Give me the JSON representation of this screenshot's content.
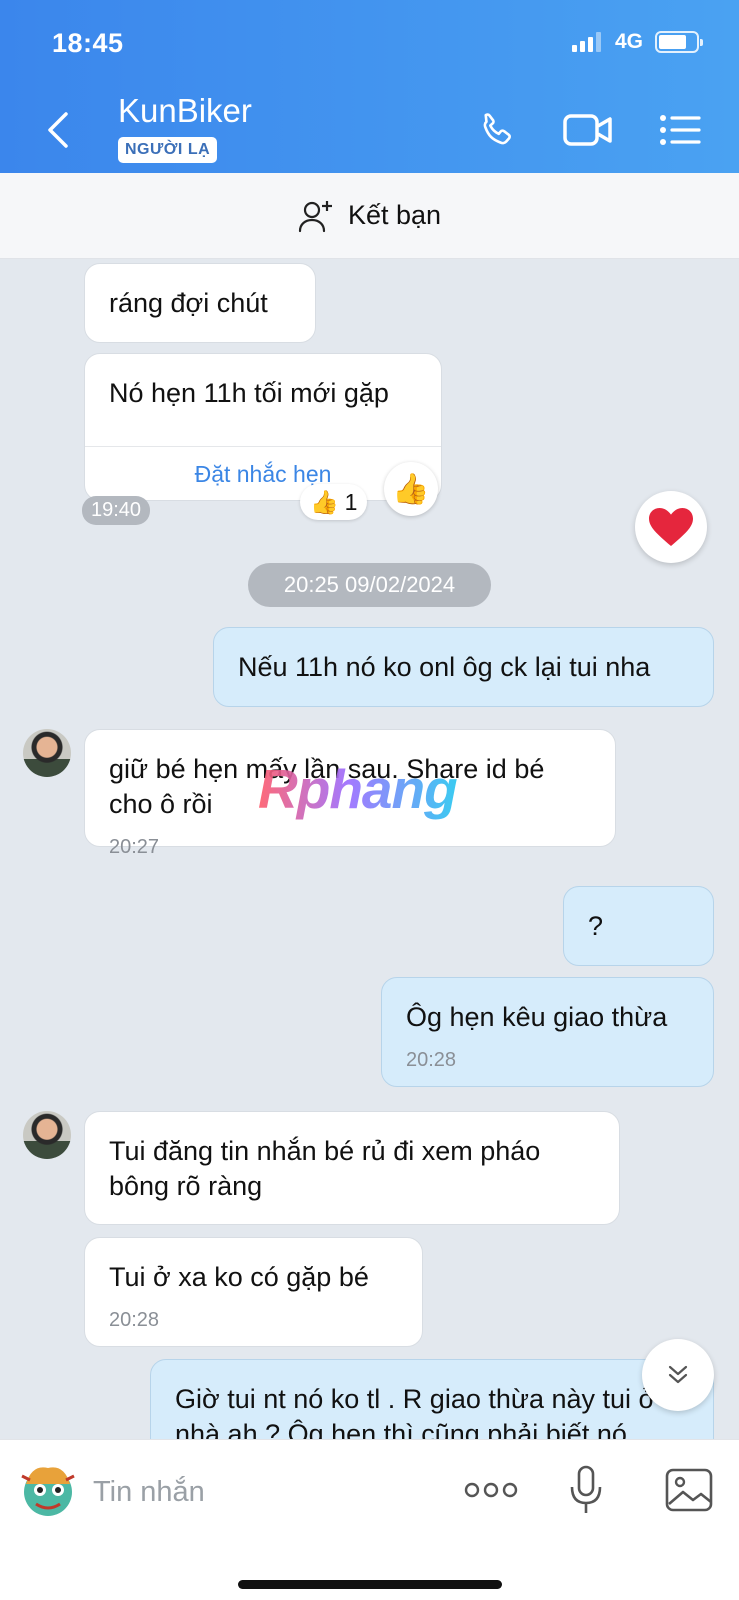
{
  "status_bar": {
    "time": "18:45",
    "network": "4G"
  },
  "header": {
    "contact_name": "KunBiker",
    "badge": "NGƯỜI LẠ"
  },
  "friend_bar": {
    "label": "Kết bạn"
  },
  "messages": [
    {
      "direction": "in",
      "text": "ráng đợi chút"
    },
    {
      "direction": "in",
      "text": "Nó hẹn 11h tối mới gặp",
      "action": "Đặt nhắc hẹn",
      "time": "19:40",
      "reaction": "👍",
      "reaction_count": "1"
    },
    {
      "divider": "20:25 09/02/2024"
    },
    {
      "direction": "out",
      "text": "Nếu 11h nó ko onl ôg ck lại tui nha"
    },
    {
      "direction": "in",
      "text": "giữ bé hẹn mấy lần sau. Share id bé cho ô rồi",
      "time": "20:27"
    },
    {
      "direction": "out",
      "text": "?"
    },
    {
      "direction": "out",
      "text": "Ôg hẹn kêu giao thừa",
      "time": "20:28"
    },
    {
      "direction": "in",
      "text": "Tui đăng tin nhắn bé rủ đi xem pháo bông rõ ràng"
    },
    {
      "direction": "in",
      "text": "Tui ở xa ko có gặp bé",
      "time": "20:28"
    },
    {
      "direction": "out",
      "text": "Giờ tui nt nó ko tl . R giao thừa này tui ở nhà ah ? Ôg hẹn thì cũng phải biết nó"
    }
  ],
  "watermark": "Rphang",
  "input": {
    "placeholder": "Tin nhắn"
  },
  "colors": {
    "header_start": "#3b86ec",
    "header_end": "#4aa2f2",
    "outgoing_bubble": "#d6ecfb",
    "link": "#3b86e5",
    "chat_bg": "#e3e8ee"
  },
  "icons": [
    "back-icon",
    "phone-icon",
    "video-call-icon",
    "menu-list-icon",
    "add-friend-icon",
    "thumbs-up-icon",
    "heart-icon",
    "chevron-double-down-icon",
    "dragon-sticker-icon",
    "more-dots-icon",
    "microphone-icon",
    "image-icon"
  ]
}
